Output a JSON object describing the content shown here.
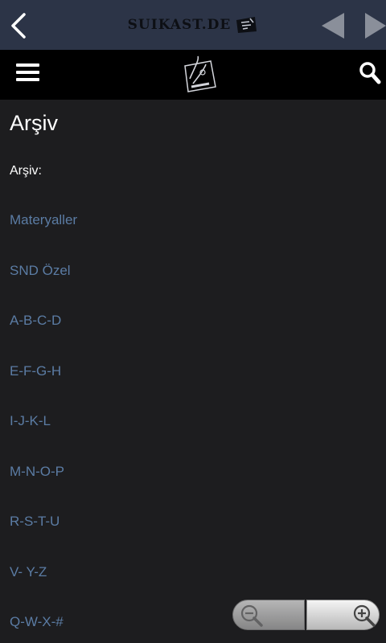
{
  "browser_bar": {
    "site_title": "SUIKAST.DE",
    "icons": [
      "back-icon",
      "prev-page-icon",
      "next-page-icon",
      "logo-icon"
    ]
  },
  "site_header": {
    "icons": [
      "hamburger-menu-icon",
      "site-logo-icon",
      "search-icon"
    ]
  },
  "page": {
    "title": "Arşiv",
    "section_label": "Arşiv:",
    "items": [
      {
        "label": "Materyaller"
      },
      {
        "label": "SND Özel"
      },
      {
        "label": "A-B-C-D"
      },
      {
        "label": "E-F-G-H"
      },
      {
        "label": "I-J-K-L"
      },
      {
        "label": "M-N-O-P"
      },
      {
        "label": "R-S-T-U"
      },
      {
        "label": "V- Y-Z"
      },
      {
        "label": "Q-W-X-#"
      }
    ],
    "link_color": "#5b7ca4"
  },
  "zoom": {
    "icons": [
      "zoom-out-icon",
      "zoom-in-icon"
    ]
  },
  "colors": {
    "top_bar": "#2c3447",
    "header": "#000000",
    "background": "#1d1d1f"
  }
}
